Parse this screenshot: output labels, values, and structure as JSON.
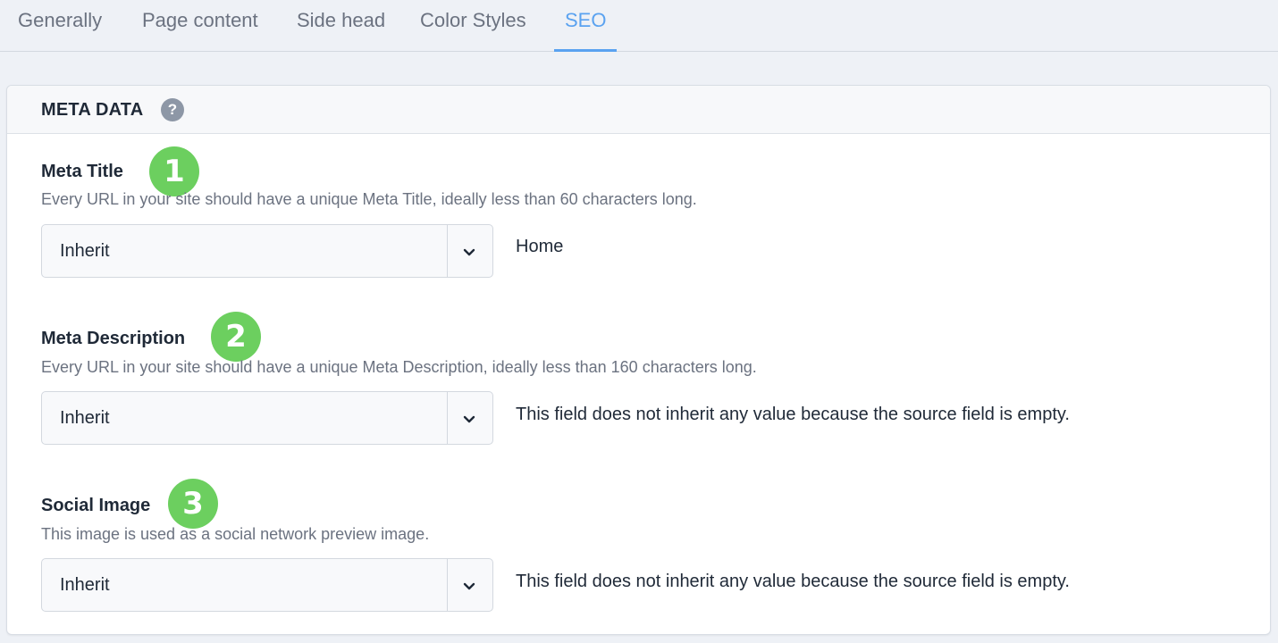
{
  "tabs": [
    {
      "label": "Generally"
    },
    {
      "label": "Page content"
    },
    {
      "label": "Side head"
    },
    {
      "label": "Color Styles"
    },
    {
      "label": "SEO",
      "active": true
    }
  ],
  "section": {
    "title": "META DATA",
    "help_icon": "question-circle-icon"
  },
  "fields": [
    {
      "badge": "1",
      "label": "Meta Title",
      "help": "Every URL in your site should have a unique Meta Title, ideally less than 60 characters long.",
      "select_value": "Inherit",
      "inherited_value": "Home"
    },
    {
      "badge": "2",
      "label": "Meta Description",
      "help": "Every URL in your site should have a unique Meta Description, ideally less than 160 characters long.",
      "select_value": "Inherit",
      "inherited_value": "This field does not inherit any value because the source field is empty."
    },
    {
      "badge": "3",
      "label": "Social Image",
      "help": "This image is used as a social network preview image.",
      "select_value": "Inherit",
      "inherited_value": "This field does not inherit any value because the source field is empty."
    }
  ],
  "colors": {
    "accent": "#5aa2f0",
    "badge": "#6ccf5f"
  }
}
